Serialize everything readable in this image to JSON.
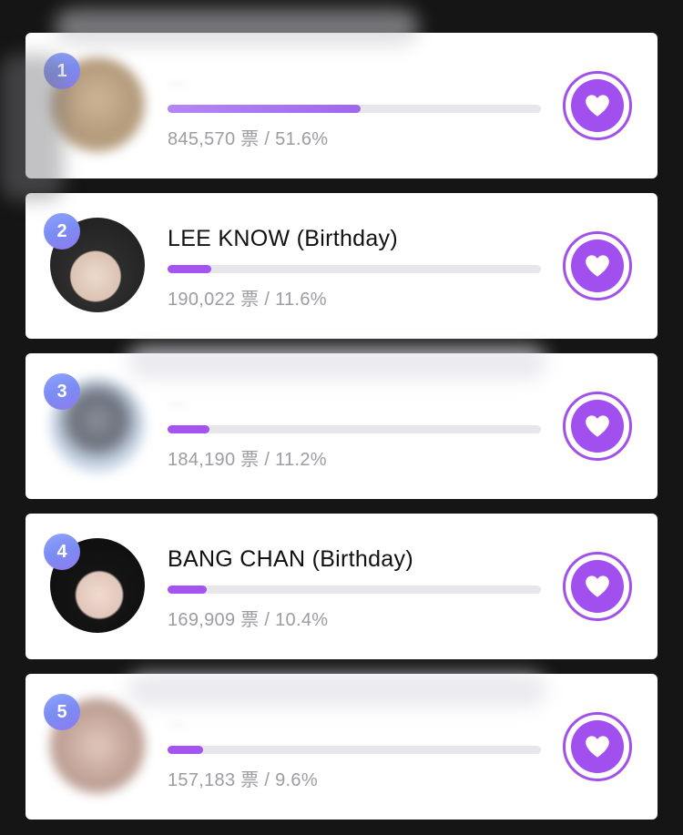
{
  "ranking": {
    "entries": [
      {
        "rank": "1",
        "name": "...",
        "stats": "845,570 票 / 51.6%",
        "percent": 51.6,
        "blurred": true,
        "avatar_colors": [
          "#b39a7a",
          "#d9c4a8"
        ]
      },
      {
        "rank": "2",
        "name": "LEE KNOW (Birthday)",
        "stats": "190,022 票 / 11.6%",
        "percent": 11.6,
        "blurred": false,
        "avatar_colors": [
          "#3a3a3a",
          "#e6d5c8"
        ]
      },
      {
        "rank": "3",
        "name": "...",
        "stats": "184,190 票 / 11.2%",
        "percent": 11.2,
        "blurred": true,
        "avatar_colors": [
          "#c9d6e6",
          "#6a6f7a"
        ]
      },
      {
        "rank": "4",
        "name": "BANG CHAN (Birthday)",
        "stats": "169,909 票 / 10.4%",
        "percent": 10.4,
        "blurred": false,
        "avatar_colors": [
          "#1a1a1a",
          "#e9d2c9"
        ]
      },
      {
        "rank": "5",
        "name": "...",
        "stats": "157,183 票 / 9.6%",
        "percent": 9.6,
        "blurred": true,
        "avatar_colors": [
          "#a88a7f",
          "#d8bdb4"
        ]
      }
    ],
    "vote_icon": "heart-icon",
    "accent_color": "#a24ff0"
  }
}
